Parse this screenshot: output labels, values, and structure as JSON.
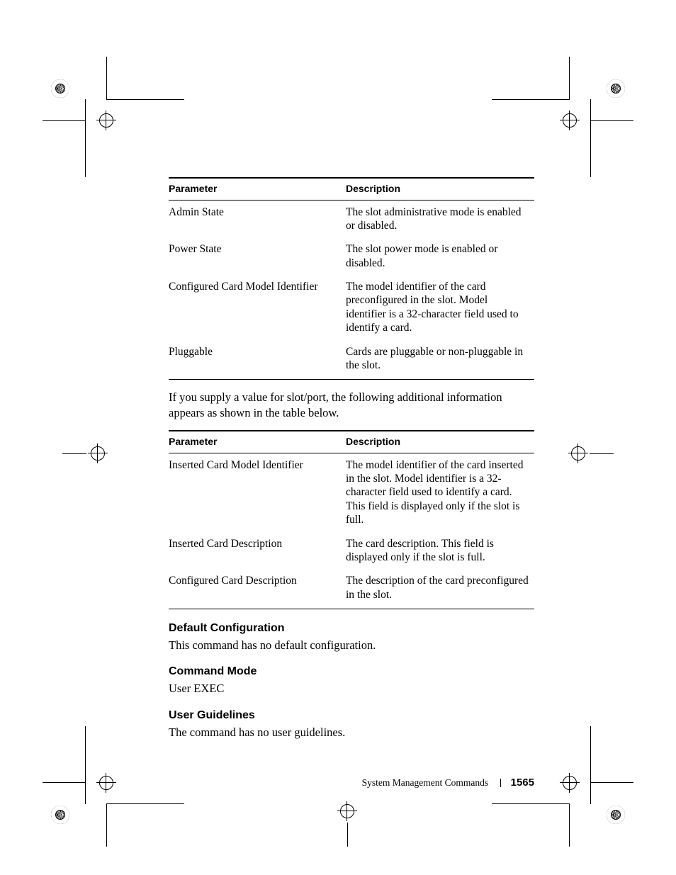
{
  "table1": {
    "head": {
      "param": "Parameter",
      "desc": "Description"
    },
    "rows": [
      {
        "param": "Admin State",
        "desc": "The slot administrative mode is enabled or disabled."
      },
      {
        "param": "Power State",
        "desc": "The slot power mode is enabled or disabled."
      },
      {
        "param": "Configured Card Model Identifier",
        "desc": "The model identifier of the card preconfigured in the slot. Model identifier is a 32-character field used to identify a card."
      },
      {
        "param": "Pluggable",
        "desc": "Cards are pluggable or non-pluggable in the slot."
      }
    ]
  },
  "midtext": "If you supply a value for slot/port, the following additional information appears as shown in the table below.",
  "table2": {
    "head": {
      "param": "Parameter",
      "desc": "Description"
    },
    "rows": [
      {
        "param": "Inserted Card Model Identifier",
        "desc": "The model identifier of the card inserted in the slot. Model identifier is a 32-character field used to identify a card. This field is displayed only if the slot is full."
      },
      {
        "param": "Inserted Card Description",
        "desc": "The card description. This field is displayed only if the slot is full."
      },
      {
        "param": "Configured Card Description",
        "desc": "The description of the card preconfigured in the slot."
      }
    ]
  },
  "sections": {
    "defcfg_h": "Default Configuration",
    "defcfg_b": "This command has no default configuration.",
    "cmdmode_h": "Command Mode",
    "cmdmode_b": "User EXEC",
    "ug_h": "User Guidelines",
    "ug_b": "The command has no user guidelines."
  },
  "footer": {
    "chapter": "System Management Commands",
    "page": "1565"
  }
}
